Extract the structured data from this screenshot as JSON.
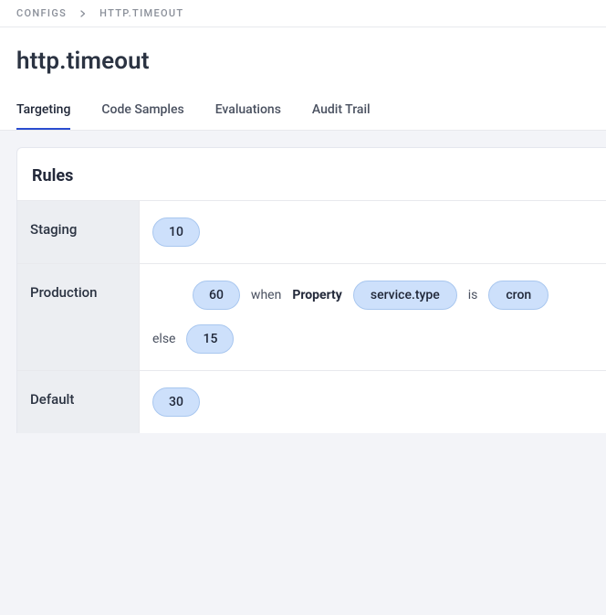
{
  "breadcrumb": {
    "root": "CONFIGS",
    "current": "HTTP.TIMEOUT"
  },
  "title": "http.timeout",
  "tabs": [
    {
      "label": "Targeting",
      "active": true
    },
    {
      "label": "Code Samples",
      "active": false
    },
    {
      "label": "Evaluations",
      "active": false
    },
    {
      "label": "Audit Trail",
      "active": false
    }
  ],
  "rules": {
    "title": "Rules",
    "rows": [
      {
        "env": "Staging",
        "lines": [
          {
            "kind": "value",
            "value": "10"
          }
        ]
      },
      {
        "env": "Production",
        "lines": [
          {
            "kind": "when",
            "value": "60",
            "when_label": "when",
            "prop_label": "Property",
            "prop_name": "service.type",
            "is_label": "is",
            "match": "cron"
          },
          {
            "kind": "else",
            "else_label": "else",
            "value": "15"
          }
        ]
      },
      {
        "env": "Default",
        "lines": [
          {
            "kind": "value",
            "value": "30"
          }
        ]
      }
    ]
  }
}
